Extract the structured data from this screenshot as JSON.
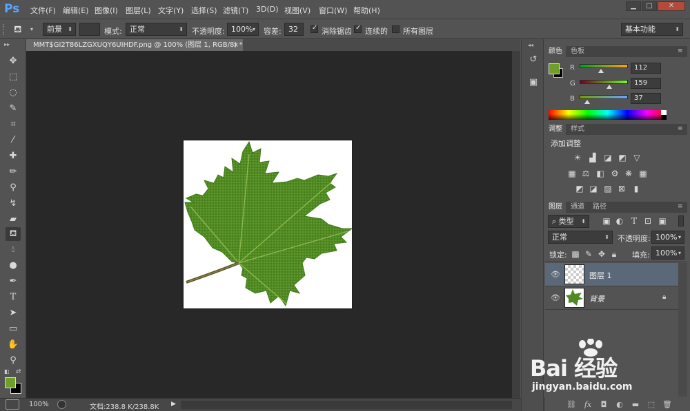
{
  "app": {
    "logo": "Ps"
  },
  "menu": [
    "文件(F)",
    "编辑(E)",
    "图像(I)",
    "图层(L)",
    "文字(Y)",
    "选择(S)",
    "滤镜(T)",
    "3D(D)",
    "视图(V)",
    "窗口(W)",
    "帮助(H)"
  ],
  "window_controls": {
    "minimize": "▁",
    "maximize": "□",
    "close": "✕"
  },
  "options": {
    "fill_source": "前景",
    "mode_label": "模式:",
    "mode_value": "正常",
    "opacity_label": "不透明度:",
    "opacity_value": "100%",
    "tolerance_label": "容差:",
    "tolerance_value": "32",
    "antialias_label": "消除锯齿",
    "contiguous_label": "连续的",
    "all_layers_label": "所有图层",
    "workspace": "基本功能"
  },
  "document": {
    "tab_title": "MMT$GI2T86LZGXUQY6UIHDF.png @ 100% (图层 1, RGB/8) *",
    "tab_close": "×"
  },
  "status": {
    "zoom": "100%",
    "doc_size": "文档:238.8 K/238.8K"
  },
  "color_panel": {
    "tabs": [
      "颜色",
      "色板"
    ],
    "foreground": "#709f25",
    "background": "#000000",
    "channels": [
      {
        "label": "R",
        "value": "112",
        "fraction": 0.44
      },
      {
        "label": "G",
        "value": "159",
        "fraction": 0.62
      },
      {
        "label": "B",
        "value": "37",
        "fraction": 0.15
      }
    ]
  },
  "adjust_panel": {
    "tabs": [
      "调整",
      "样式"
    ],
    "title": "添加调整"
  },
  "layers_panel": {
    "tabs": [
      "图层",
      "通道",
      "路径"
    ],
    "filter": "类型",
    "blend_mode": "正常",
    "opacity_label": "不透明度:",
    "opacity_value": "100%",
    "lock_label": "锁定:",
    "fill_label": "填充:",
    "fill_value": "100%",
    "layers": [
      {
        "name": "图层 1",
        "selected": true
      },
      {
        "name": "背景",
        "selected": false,
        "locked": true
      }
    ]
  },
  "colors": {
    "accent": "#5aa3ff",
    "panel": "#535353",
    "canvas": "#282828",
    "selected_layer": "#5a6878"
  },
  "watermark": {
    "brand": "Bai 经验",
    "url": "jingyan.baidu.com"
  }
}
